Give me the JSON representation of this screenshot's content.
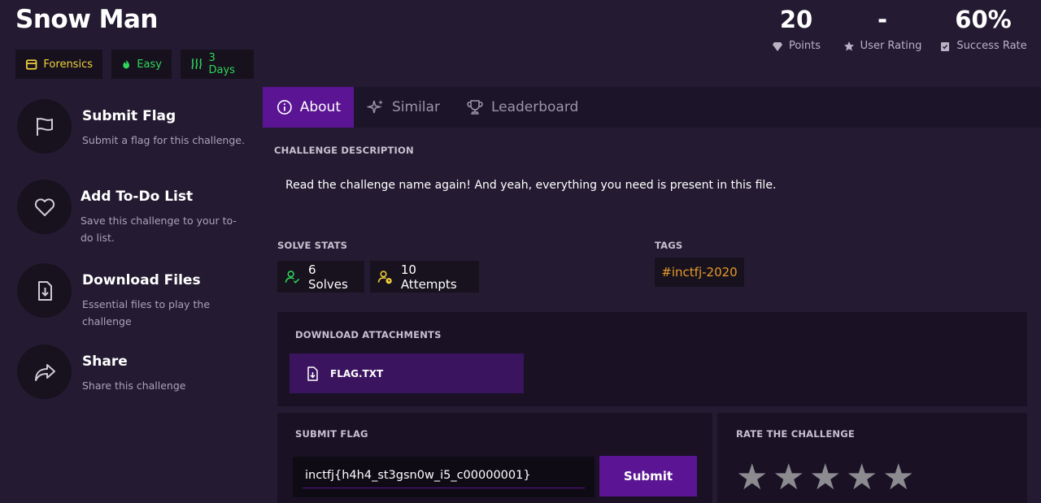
{
  "challenge": {
    "title": "Snow Man",
    "category": "Forensics",
    "difficulty": "Easy",
    "duration": "3 Days"
  },
  "stats": [
    {
      "value": "20",
      "label": "Points",
      "icon": "gem-icon"
    },
    {
      "value": "-",
      "label": "User Rating",
      "icon": "star-icon"
    },
    {
      "value": "60%",
      "label": "Success Rate",
      "icon": "clipboard-check-icon"
    }
  ],
  "actions": [
    {
      "title": "Submit Flag",
      "desc": "Submit a flag for this challenge.",
      "icon": "flag-icon"
    },
    {
      "title": "Add To-Do List",
      "desc": "Save this challenge to your to-do list.",
      "icon": "heart-icon"
    },
    {
      "title": "Download Files",
      "desc": "Essential files to play the challenge",
      "icon": "file-download-icon"
    },
    {
      "title": "Share",
      "desc": "Share this challenge",
      "icon": "share-icon"
    }
  ],
  "tabs": [
    {
      "label": "About",
      "icon": "info-icon",
      "active": true
    },
    {
      "label": "Similar",
      "icon": "sparkle-icon",
      "active": false
    },
    {
      "label": "Leaderboard",
      "icon": "trophy-icon",
      "active": false
    }
  ],
  "about": {
    "description_label": "CHALLENGE DESCRIPTION",
    "description": "Read the challenge name again! And yeah, everything you need is present in this file.",
    "solve_stats_label": "SOLVE STATS",
    "solves": "6 Solves",
    "attempts": "10 Attempts",
    "tags_label": "TAGS",
    "tags": [
      "#inctfj-2020"
    ]
  },
  "attachments": {
    "label": "DOWNLOAD ATTACHMENTS",
    "files": [
      "FLAG.TXT"
    ]
  },
  "submit": {
    "label": "SUBMIT FLAG",
    "value": "inctfj{h4h4_st3gsn0w_i5_c00000001}",
    "button": "Submit"
  },
  "rate": {
    "label": "RATE THE CHALLENGE",
    "stars": 5
  },
  "colors": {
    "background": "#241b32",
    "accent": "#5b1594",
    "category": "#f3d23c",
    "success": "#2fd75b",
    "tag": "#e79a2a"
  }
}
